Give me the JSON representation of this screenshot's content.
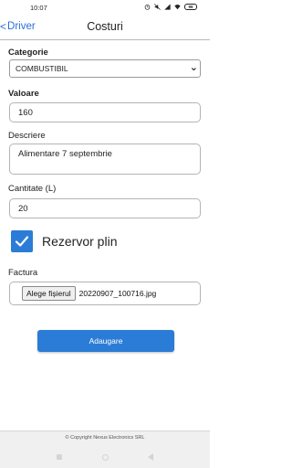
{
  "status_bar": {
    "time": "10:07",
    "battery": "96",
    "icons": [
      "alarm-icon",
      "mute-icon",
      "signal-icon",
      "wifi-icon",
      "battery-icon"
    ]
  },
  "app_bar": {
    "back_label": "Driver",
    "title": "Costuri"
  },
  "form": {
    "categorie": {
      "label": "Categorie",
      "selected": "COMBUSTIBIL"
    },
    "valoare": {
      "label": "Valoare",
      "value": "160"
    },
    "descriere": {
      "label": "Descriere",
      "value": "Alimentare 7 septembrie"
    },
    "cantitate": {
      "label": "Cantitate (L)",
      "value": "20"
    },
    "rezervor": {
      "label": "Rezervor plin",
      "checked": true
    },
    "factura": {
      "label": "Factura",
      "button_label": "Alege fișierul",
      "file_name": "20220907_100716.jpg"
    },
    "submit_label": "Adaugare"
  },
  "footer": {
    "copyright": "© Copyright Nexus Electronics SRL"
  },
  "colors": {
    "accent": "#2b7cd6",
    "link": "#2a6fdb"
  }
}
